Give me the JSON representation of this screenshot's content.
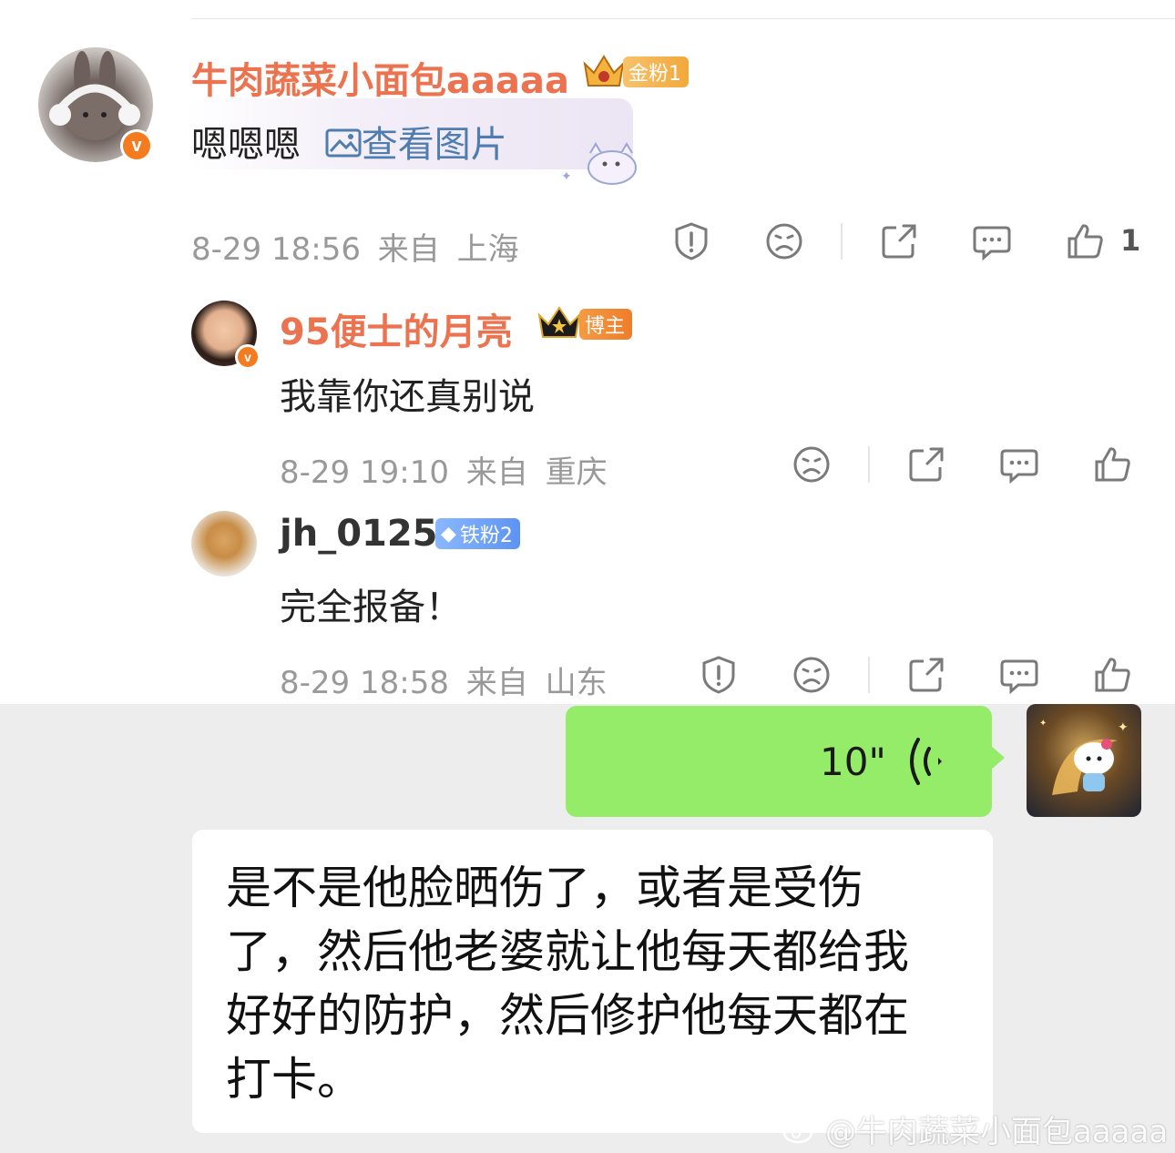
{
  "comments": [
    {
      "user": "牛肉蔬菜小面包aaaaa",
      "badge": "金粉1",
      "text": "嗯嗯嗯",
      "image_link": "查看图片",
      "time": "8-29 18:56",
      "from": "来自",
      "location": "上海",
      "likes": "1"
    },
    {
      "user": "95便士的月亮",
      "badge": "博主",
      "text": "我靠你还真别说",
      "time": "8-29 19:10",
      "from": "来自",
      "location": "重庆"
    },
    {
      "user": "jh_0125",
      "badge": "铁粉2",
      "text": "完全报备！",
      "time": "8-29 18:58",
      "from": "来自",
      "location": "山东"
    }
  ],
  "chat": {
    "voice_duration": "10\"",
    "reply_lines": [
      "是不是他脸晒伤了，或者是受伤",
      "了，然后他老婆就让他每天都给我",
      "好好的防护，然后修护他每天都在",
      "打卡。"
    ]
  },
  "watermark": "@牛肉蔬菜小面包aaaaa",
  "colors": {
    "username": "#eb7350",
    "link": "#507daf",
    "voice_bubble": "#95ec69",
    "chat_bg": "#ededed",
    "v_badge": "#f47b20"
  }
}
